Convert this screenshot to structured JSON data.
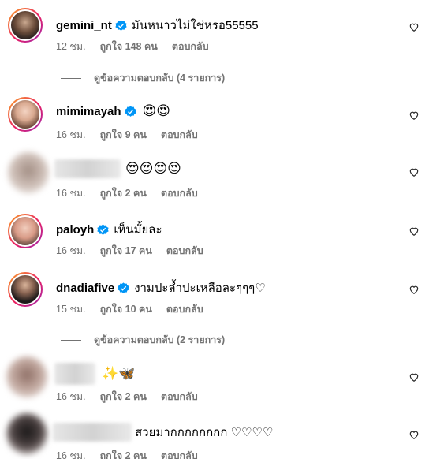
{
  "comments": [
    {
      "username": "gemini_nt",
      "text": "มันหนาวไม่ใช่หรอ55555",
      "emoji": "",
      "time": "12 ชม.",
      "likes": "ถูกใจ 148 คน",
      "reply": "ตอบกลับ"
    },
    {
      "username": "mimimayah",
      "text": "",
      "emoji": "😍😍",
      "time": "16 ชม.",
      "likes": "ถูกใจ 9 คน",
      "reply": "ตอบกลับ"
    },
    {
      "username": "",
      "text": "",
      "emoji": "😍😍😍😍",
      "time": "16 ชม.",
      "likes": "ถูกใจ 2 คน",
      "reply": "ตอบกลับ"
    },
    {
      "username": "paloyh",
      "text": "เห็นมั้ยละ",
      "emoji": "",
      "time": "16 ชม.",
      "likes": "ถูกใจ 17 คน",
      "reply": "ตอบกลับ"
    },
    {
      "username": "dnadiafive",
      "text": "งามปะล้ำปะเหลือละๆๆๆ♡",
      "emoji": "",
      "time": "15 ชม.",
      "likes": "ถูกใจ 10 คน",
      "reply": "ตอบกลับ"
    },
    {
      "username": "",
      "text": "",
      "emoji": "✨🦋",
      "time": "16 ชม.",
      "likes": "ถูกใจ 2 คน",
      "reply": "ตอบกลับ"
    },
    {
      "username": "",
      "text": "สวยมากกกกกกกก ♡♡♡♡",
      "emoji": "",
      "time": "16 ชม.",
      "likes": "ถูกใจ 2 คน",
      "reply": "ตอบกลับ"
    }
  ],
  "view_replies": [
    {
      "label": "ดูข้อความตอบกลับ (4 รายการ)"
    },
    {
      "label": "ดูข้อความตอบกลับ (2 รายการ)"
    }
  ],
  "colors": {
    "verified": "#0095f6",
    "meta": "#737373"
  }
}
